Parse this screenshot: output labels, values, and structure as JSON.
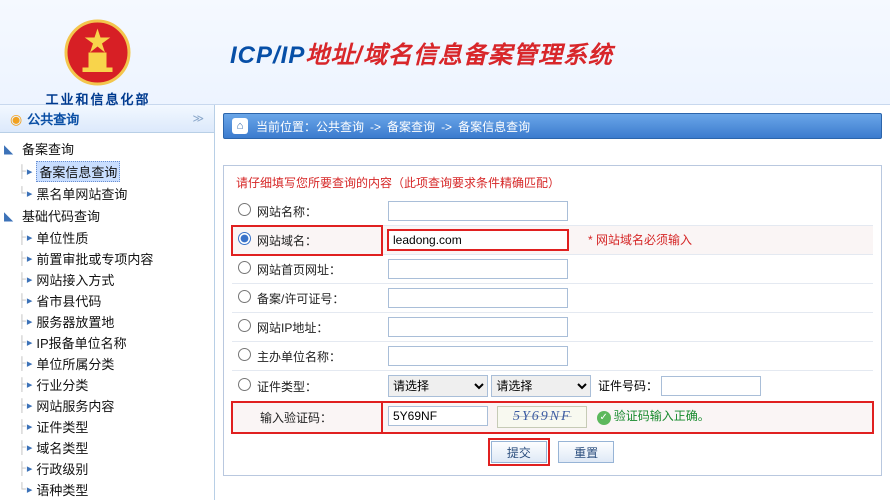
{
  "header": {
    "org_name": "工业和信息化部",
    "title_icp": "ICP",
    "title_ip": "/IP",
    "title_rest": "地址/域名信息备案管理系统"
  },
  "sidebar": {
    "section_title": "公共查询",
    "groups": [
      {
        "label": "备案查询",
        "items": [
          {
            "label": "备案信息查询",
            "selected": true
          },
          {
            "label": "黑名单网站查询"
          }
        ]
      },
      {
        "label": "基础代码查询",
        "items": [
          {
            "label": "单位性质"
          },
          {
            "label": "前置审批或专项内容"
          },
          {
            "label": "网站接入方式"
          },
          {
            "label": "省市县代码"
          },
          {
            "label": "服务器放置地"
          },
          {
            "label": "IP报备单位名称"
          },
          {
            "label": "单位所属分类"
          },
          {
            "label": "行业分类"
          },
          {
            "label": "网站服务内容"
          },
          {
            "label": "证件类型"
          },
          {
            "label": "域名类型"
          },
          {
            "label": "行政级别"
          },
          {
            "label": "语种类型"
          }
        ]
      }
    ]
  },
  "breadcrumb": {
    "prefix": "当前位置：",
    "items": [
      "公共查询",
      "备案查询",
      "备案信息查询"
    ],
    "sep": "->"
  },
  "form": {
    "instruction": "请仔细填写您所要查询的内容（此项查询要求条件精确匹配）",
    "rows": {
      "site_name": {
        "label": "网站名称：",
        "value": ""
      },
      "site_domain": {
        "label": "网站域名：",
        "value": "leadong.com",
        "required_note": "* 网站域名必须输入"
      },
      "homepage": {
        "label": "网站首页网址：",
        "value": ""
      },
      "license": {
        "label": "备案/许可证号：",
        "value": ""
      },
      "ip": {
        "label": "网站IP地址：",
        "value": ""
      },
      "sponsor": {
        "label": "主办单位名称：",
        "value": ""
      },
      "cert_type": {
        "label": "证件类型：",
        "select1_placeholder": "请选择",
        "select2_placeholder": "请选择",
        "cert_no_label": "证件号码：",
        "cert_no_value": ""
      },
      "captcha": {
        "label": "输入验证码：",
        "value": "5Y69NF",
        "image_text": "5Y69NF",
        "status": "验证码输入正确。"
      }
    },
    "buttons": {
      "submit": "提交",
      "reset": "重置"
    }
  }
}
